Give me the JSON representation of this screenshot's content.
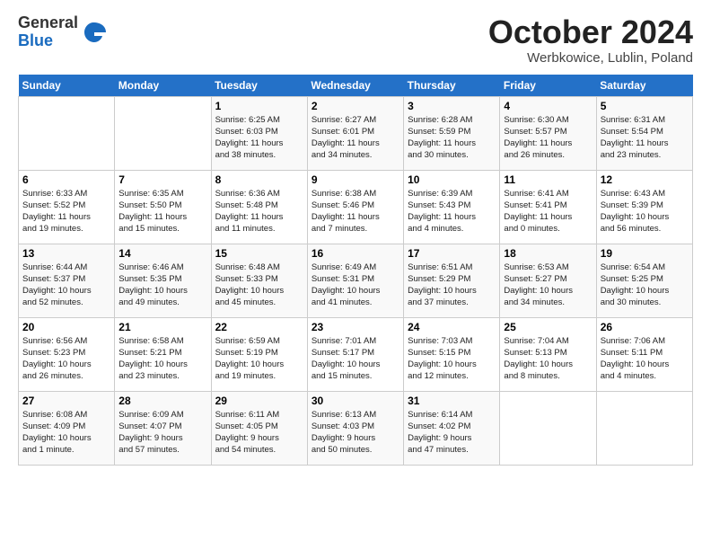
{
  "header": {
    "logo_general": "General",
    "logo_blue": "Blue",
    "month_title": "October 2024",
    "location": "Werbkowice, Lublin, Poland"
  },
  "weekdays": [
    "Sunday",
    "Monday",
    "Tuesday",
    "Wednesday",
    "Thursday",
    "Friday",
    "Saturday"
  ],
  "weeks": [
    [
      {
        "day": "",
        "info": ""
      },
      {
        "day": "",
        "info": ""
      },
      {
        "day": "1",
        "info": "Sunrise: 6:25 AM\nSunset: 6:03 PM\nDaylight: 11 hours\nand 38 minutes."
      },
      {
        "day": "2",
        "info": "Sunrise: 6:27 AM\nSunset: 6:01 PM\nDaylight: 11 hours\nand 34 minutes."
      },
      {
        "day": "3",
        "info": "Sunrise: 6:28 AM\nSunset: 5:59 PM\nDaylight: 11 hours\nand 30 minutes."
      },
      {
        "day": "4",
        "info": "Sunrise: 6:30 AM\nSunset: 5:57 PM\nDaylight: 11 hours\nand 26 minutes."
      },
      {
        "day": "5",
        "info": "Sunrise: 6:31 AM\nSunset: 5:54 PM\nDaylight: 11 hours\nand 23 minutes."
      }
    ],
    [
      {
        "day": "6",
        "info": "Sunrise: 6:33 AM\nSunset: 5:52 PM\nDaylight: 11 hours\nand 19 minutes."
      },
      {
        "day": "7",
        "info": "Sunrise: 6:35 AM\nSunset: 5:50 PM\nDaylight: 11 hours\nand 15 minutes."
      },
      {
        "day": "8",
        "info": "Sunrise: 6:36 AM\nSunset: 5:48 PM\nDaylight: 11 hours\nand 11 minutes."
      },
      {
        "day": "9",
        "info": "Sunrise: 6:38 AM\nSunset: 5:46 PM\nDaylight: 11 hours\nand 7 minutes."
      },
      {
        "day": "10",
        "info": "Sunrise: 6:39 AM\nSunset: 5:43 PM\nDaylight: 11 hours\nand 4 minutes."
      },
      {
        "day": "11",
        "info": "Sunrise: 6:41 AM\nSunset: 5:41 PM\nDaylight: 11 hours\nand 0 minutes."
      },
      {
        "day": "12",
        "info": "Sunrise: 6:43 AM\nSunset: 5:39 PM\nDaylight: 10 hours\nand 56 minutes."
      }
    ],
    [
      {
        "day": "13",
        "info": "Sunrise: 6:44 AM\nSunset: 5:37 PM\nDaylight: 10 hours\nand 52 minutes."
      },
      {
        "day": "14",
        "info": "Sunrise: 6:46 AM\nSunset: 5:35 PM\nDaylight: 10 hours\nand 49 minutes."
      },
      {
        "day": "15",
        "info": "Sunrise: 6:48 AM\nSunset: 5:33 PM\nDaylight: 10 hours\nand 45 minutes."
      },
      {
        "day": "16",
        "info": "Sunrise: 6:49 AM\nSunset: 5:31 PM\nDaylight: 10 hours\nand 41 minutes."
      },
      {
        "day": "17",
        "info": "Sunrise: 6:51 AM\nSunset: 5:29 PM\nDaylight: 10 hours\nand 37 minutes."
      },
      {
        "day": "18",
        "info": "Sunrise: 6:53 AM\nSunset: 5:27 PM\nDaylight: 10 hours\nand 34 minutes."
      },
      {
        "day": "19",
        "info": "Sunrise: 6:54 AM\nSunset: 5:25 PM\nDaylight: 10 hours\nand 30 minutes."
      }
    ],
    [
      {
        "day": "20",
        "info": "Sunrise: 6:56 AM\nSunset: 5:23 PM\nDaylight: 10 hours\nand 26 minutes."
      },
      {
        "day": "21",
        "info": "Sunrise: 6:58 AM\nSunset: 5:21 PM\nDaylight: 10 hours\nand 23 minutes."
      },
      {
        "day": "22",
        "info": "Sunrise: 6:59 AM\nSunset: 5:19 PM\nDaylight: 10 hours\nand 19 minutes."
      },
      {
        "day": "23",
        "info": "Sunrise: 7:01 AM\nSunset: 5:17 PM\nDaylight: 10 hours\nand 15 minutes."
      },
      {
        "day": "24",
        "info": "Sunrise: 7:03 AM\nSunset: 5:15 PM\nDaylight: 10 hours\nand 12 minutes."
      },
      {
        "day": "25",
        "info": "Sunrise: 7:04 AM\nSunset: 5:13 PM\nDaylight: 10 hours\nand 8 minutes."
      },
      {
        "day": "26",
        "info": "Sunrise: 7:06 AM\nSunset: 5:11 PM\nDaylight: 10 hours\nand 4 minutes."
      }
    ],
    [
      {
        "day": "27",
        "info": "Sunrise: 6:08 AM\nSunset: 4:09 PM\nDaylight: 10 hours\nand 1 minute."
      },
      {
        "day": "28",
        "info": "Sunrise: 6:09 AM\nSunset: 4:07 PM\nDaylight: 9 hours\nand 57 minutes."
      },
      {
        "day": "29",
        "info": "Sunrise: 6:11 AM\nSunset: 4:05 PM\nDaylight: 9 hours\nand 54 minutes."
      },
      {
        "day": "30",
        "info": "Sunrise: 6:13 AM\nSunset: 4:03 PM\nDaylight: 9 hours\nand 50 minutes."
      },
      {
        "day": "31",
        "info": "Sunrise: 6:14 AM\nSunset: 4:02 PM\nDaylight: 9 hours\nand 47 minutes."
      },
      {
        "day": "",
        "info": ""
      },
      {
        "day": "",
        "info": ""
      }
    ]
  ]
}
